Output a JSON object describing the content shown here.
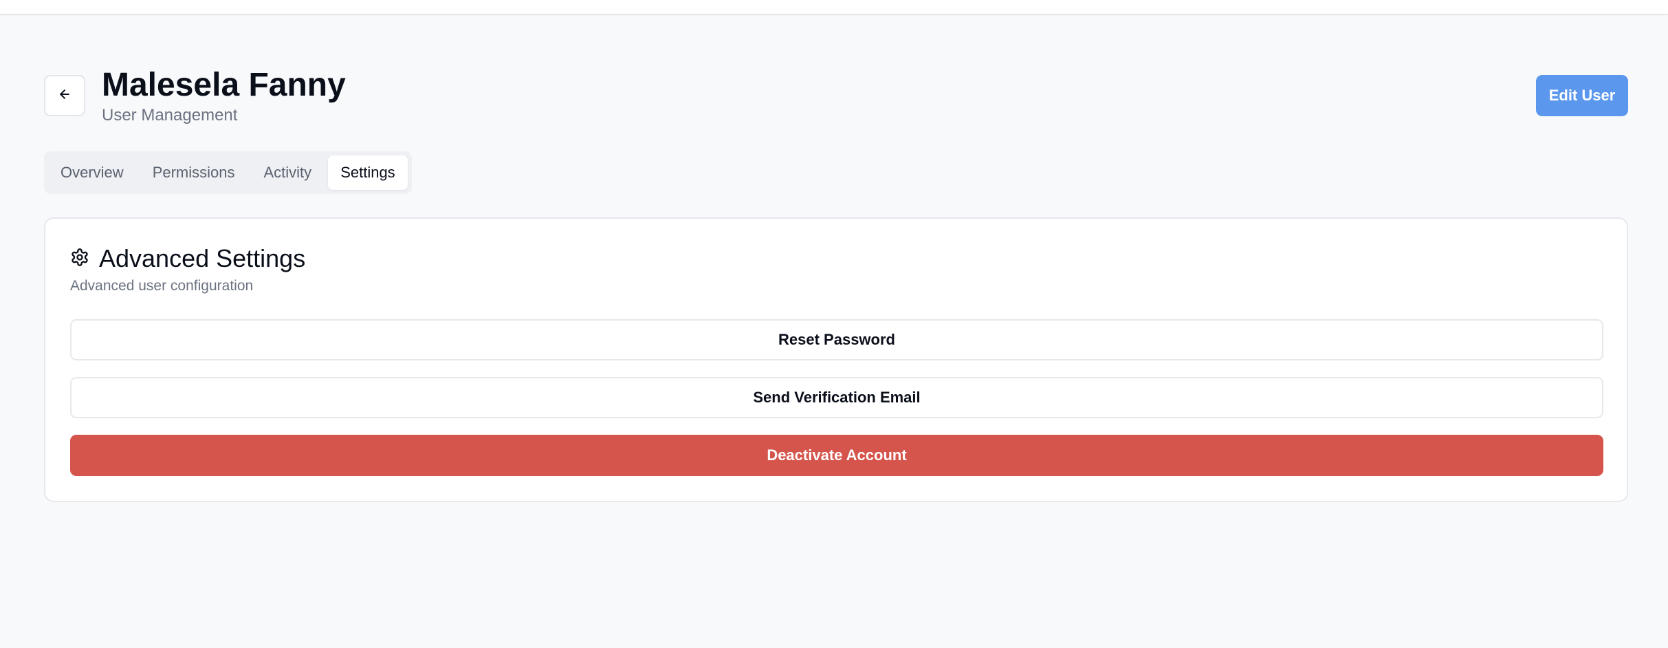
{
  "header": {
    "title": "Malesela Fanny",
    "subtitle": "User Management",
    "edit_label": "Edit User",
    "accent": "#5b98ed"
  },
  "tabs": [
    {
      "label": "Overview",
      "active": false
    },
    {
      "label": "Permissions",
      "active": false
    },
    {
      "label": "Activity",
      "active": false
    },
    {
      "label": "Settings",
      "active": true
    }
  ],
  "card": {
    "icon": "gear-icon",
    "title": "Advanced Settings",
    "description": "Advanced user configuration",
    "actions": {
      "reset_password": "Reset Password",
      "send_verification": "Send Verification Email",
      "deactivate": "Deactivate Account"
    },
    "danger_color": "#d5544c"
  },
  "icons": {
    "back": "arrow-left-icon"
  }
}
